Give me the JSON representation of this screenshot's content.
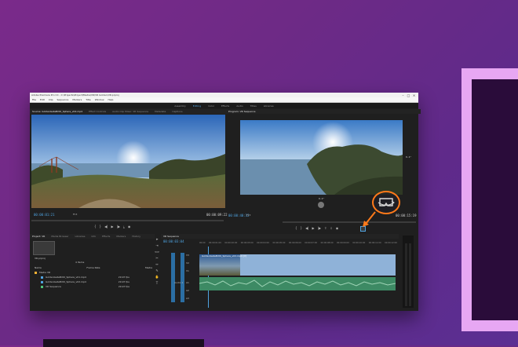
{
  "window": {
    "title": "Adobe Premiere Pro CC - C:\\Projects\\Project\\Media\\VR\\VR Golden\\VR.prproj",
    "controls": [
      "–",
      "□",
      "×"
    ]
  },
  "menu": [
    "File",
    "Edit",
    "Clip",
    "Sequence",
    "Markers",
    "Title",
    "Window",
    "Help"
  ],
  "workspaces": {
    "items": [
      "Assembly",
      "Editing",
      "Color",
      "Effects",
      "Audio",
      "Titles",
      "Libraries"
    ],
    "active_index": 1
  },
  "source_panel": {
    "tabs": [
      "Source: GoldenGateBr00_Sphere_v02.mp4",
      "Effect Controls",
      "Audio Clip Mixer: VR Sequence",
      "Metadata",
      "Captions"
    ],
    "timecode_in": "00:00:01:21",
    "timecode_out": "00:00:09:22",
    "fit": "Fit"
  },
  "program_panel": {
    "tabs": [
      "Program: VR Sequence"
    ],
    "timecode_in": "00:00:40:12",
    "timecode_out": "00:00:15:19",
    "fit": "Fit",
    "side_value": "0.4°",
    "bottom_value": "0.4°"
  },
  "project_panel": {
    "tabs": [
      "Project: VR",
      "Media Browser",
      "Libraries",
      "Info",
      "Effects",
      "Markers",
      "History"
    ],
    "project_file": "VR.prproj",
    "count": "4 Items",
    "columns": [
      "Name",
      "Frame Rate",
      "Media"
    ],
    "items": [
      {
        "name": "Media VR",
        "rate": "",
        "color": "#f2b233"
      },
      {
        "name": "GoldenGateBr00_Sphere_v01.mp4",
        "rate": "29.97 fps",
        "color": "#4fa3e0"
      },
      {
        "name": "GoldenGateBr00_Sphere_v02.mp4",
        "rate": "29.97 fps",
        "color": "#4fa3e0"
      },
      {
        "name": "VR Sequence",
        "rate": "29.97 fps",
        "color": "#4fc47a"
      }
    ]
  },
  "timeline": {
    "tab": "VR Sequence",
    "timecode": "00:00:03:04",
    "ruler": [
      "00:00",
      "00:00:01:00",
      "00:00:02:00",
      "00:00:03:00",
      "00:00:04:00",
      "00:00:05:00",
      "00:00:06:00",
      "00:00:07:00",
      "00:00:08:00",
      "00:00:09:00",
      "00:00:10:00",
      "00:00:11:00",
      "00:00:12:00"
    ],
    "video_tracks": [
      "V3",
      "V2",
      "V1"
    ],
    "audio_tracks": [
      "A1",
      "A2",
      "A3"
    ],
    "clip_name": "GoldenGateBr00_Sphere_v02.mp4 [V]",
    "audio_label": "Audio 1"
  },
  "colors": {
    "accent": "#4fa3e0",
    "highlight": "#ff7a1a",
    "background_purple": "#6e2a86",
    "frame_pink": "#e7a7f3",
    "clip_blue": "#8fb2d8",
    "audio_green": "#3d8a64"
  },
  "icons": [
    "vr-toggle-icon",
    "play-icon",
    "step-back-icon",
    "step-forward-icon",
    "wrench-icon",
    "selection-tool-icon",
    "razor-tool-icon",
    "hand-tool-icon",
    "type-tool-icon"
  ]
}
